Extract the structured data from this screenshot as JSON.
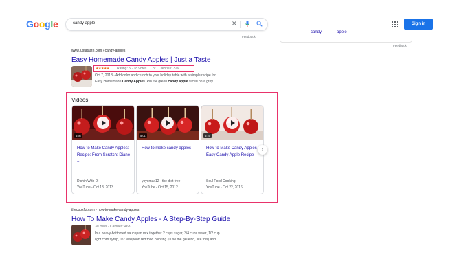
{
  "header": {
    "logo_letters": [
      {
        "ch": "G",
        "color": "#4285f4"
      },
      {
        "ch": "o",
        "color": "#ea4335"
      },
      {
        "ch": "o",
        "color": "#fbbc05"
      },
      {
        "ch": "g",
        "color": "#4285f4"
      },
      {
        "ch": "l",
        "color": "#34a853"
      },
      {
        "ch": "e",
        "color": "#ea4335"
      }
    ],
    "search_value": "candy apple",
    "clear_icon": "close-icon",
    "mic_icon": "mic-icon",
    "search_icon": "search-icon",
    "feedback": "Feedback",
    "apps_icon": "apps-grid-icon",
    "signin_label": "Sign in",
    "accent_color": "#1a73e8"
  },
  "knowledge_panel": {
    "items": [
      "candy",
      "apple"
    ],
    "feedback": "Feedback"
  },
  "result1": {
    "url": "www.justataste.com › candy-apples",
    "title": "Easy Homemade Candy Apples | Just a Taste",
    "stars": "★★★★★",
    "rating_text": "Rating: 5 · 18 votes · 1 hr · Calories: 326",
    "snippet_line1": "Oct 7, 2018 · Add color and crunch to your holiday table with a simple recipe for",
    "snippet_line2_a": "Easy Homemade ",
    "snippet_line2_b": "Candy Apples",
    "snippet_line2_c": ". Pin it A green ",
    "snippet_line2_d": "candy apple",
    "snippet_line2_e": " sliced on a grey ..."
  },
  "videos": {
    "heading": "Videos",
    "highlight_color": "#e8336b",
    "cards": [
      {
        "duration": "4:56",
        "title": "How to Make Candy Apples: Recipe: From Scratch: Diane ...",
        "channel": "Dishin With Di",
        "meta": "YouTube - Oct 18, 2013"
      },
      {
        "duration": "5:01",
        "title": "How to make candy apples",
        "channel": "yoyomax12 - the diet free",
        "meta": "YouTube - Oct 15, 2012"
      },
      {
        "duration": "4:16",
        "title": "How to Make Candy Apples - Easy Candy Apple Recipe",
        "channel": "Soul Food Cooking",
        "meta": "YouTube - Oct 22, 2016"
      }
    ],
    "next_icon": "chevron-right-icon",
    "next_glyph": "›"
  },
  "result2": {
    "url": "thecookful.com › how-to-make-candy-apples",
    "title": "How To Make Candy Apples - A Step-By-Step Guide",
    "meta": "30 mins · Calories: 468",
    "snippet_line1": "In a heavy-bottomed saucepan mix together 2 cups sugar, 3/4 cups water, 1/2 cup",
    "snippet_line2": "light corn syrup, 1/2 teaspoon red food coloring (I use the gel kind, like this) and ..."
  }
}
